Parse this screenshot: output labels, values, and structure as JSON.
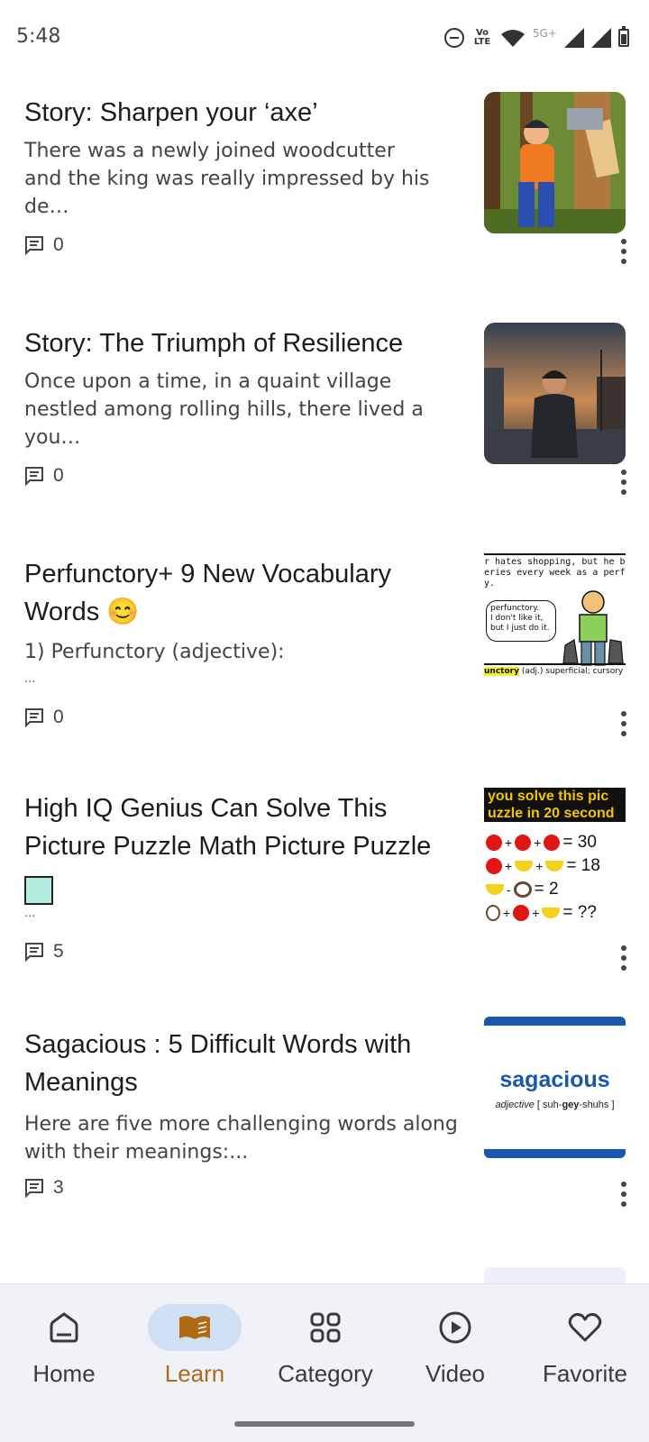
{
  "status": {
    "time": "5:48",
    "volte": "Vo LTE",
    "network": "5G+"
  },
  "feed": [
    {
      "title": "Story: Sharpen your ‘axe’",
      "excerpt_lines": [
        "There was a newly joined woodcutter",
        "and the king was really impressed by his de…"
      ],
      "comments": "0"
    },
    {
      "title": "Story: The Triumph of Resilience",
      "excerpt_lines": [
        "Once upon a time, in a quaint village",
        "nestled among rolling hills, there lived a you…"
      ],
      "comments": "0"
    },
    {
      "title_lines": [
        "Perfunctory+ 9 New Vocabulary",
        "Words 😊"
      ],
      "excerpt_lines": [
        "1) Perfunctory (adjective):"
      ],
      "ellipsis": "...",
      "comments": "0",
      "thumb": {
        "line1": "r hates shopping, but he bought",
        "line2": "eries every week as a perfuncto",
        "line3": "y.",
        "bubble1": "perfunctory.",
        "bubble2": "I don't like it,",
        "bubble3": "but I just do it.",
        "definition_word": "unctory",
        "definition_rest": " (adj.) superficial; cursory"
      }
    },
    {
      "title_lines": [
        "High IQ Genius Can Solve This",
        "Picture Puzzle Math Picture Puzzle"
      ],
      "ellipsis": "...",
      "comments": "5",
      "thumb": {
        "header1": "you solve this pic",
        "header2": "uzzle in 20 second",
        "row1": "= 30",
        "row2": "= 18",
        "row3": "= 2",
        "row4": "= ??"
      }
    },
    {
      "title_lines": [
        "Sagacious : 5 Difficult Words with",
        "Meanings"
      ],
      "excerpt_lines": [
        "Here are five more challenging words along",
        "with their meanings:..."
      ],
      "comments": "3",
      "thumb": {
        "word": "sagacious",
        "pos": "adjective",
        "pron_a": "[ suh-",
        "pron_b": "gey",
        "pron_c": "-shuhs ]"
      }
    }
  ],
  "nav": [
    {
      "label": "Home",
      "icon": "home-icon"
    },
    {
      "label": "Learn",
      "icon": "book-icon",
      "active": true
    },
    {
      "label": "Category",
      "icon": "grid-icon"
    },
    {
      "label": "Video",
      "icon": "play-circle-icon"
    },
    {
      "label": "Favorite",
      "icon": "heart-icon"
    }
  ],
  "colors": {
    "accent": "#b06a13",
    "nav_active_bg": "#cfe0f5",
    "nav_bg": "#f0f2f7",
    "sagacious_blue": "#1a56b0"
  }
}
